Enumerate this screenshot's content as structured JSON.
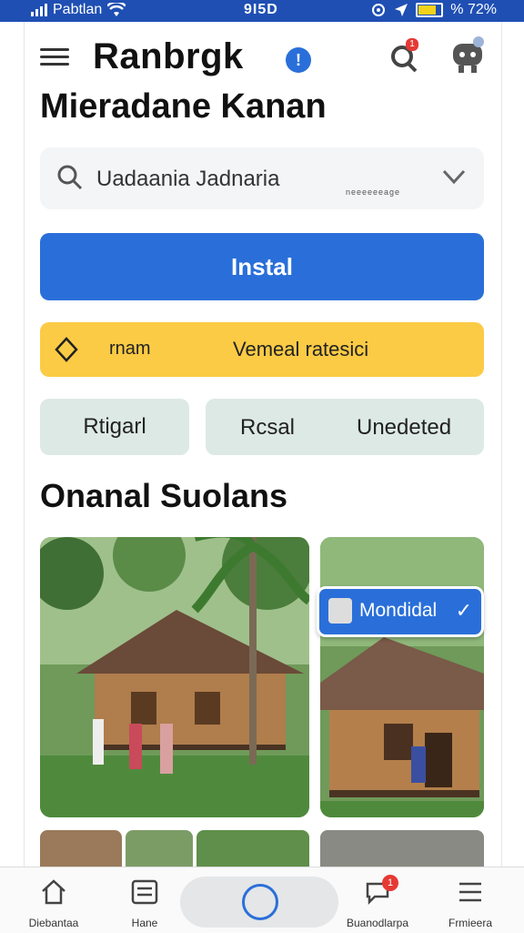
{
  "status_bar": {
    "carrier": "Pabtlan",
    "time": "9I5D",
    "battery": "%  72%"
  },
  "header": {
    "app_title": "Ranbrgk",
    "info_glyph": "!",
    "page_title": "Mieradane Kanan"
  },
  "search": {
    "value": "Uadaania Jadnaria",
    "hint": "neeeeeeage"
  },
  "install_button": {
    "label": "Instal"
  },
  "notice": {
    "tag": "rnam",
    "message": "Vemeal ratesici"
  },
  "chips": {
    "first": "Rtigarl",
    "second_a": "Rcsal",
    "second_b": "Unedeted"
  },
  "section": {
    "title": "Onanal Suolans"
  },
  "verified_badge": {
    "label": "Mondidal",
    "check": "✓"
  },
  "nav": {
    "items": [
      {
        "label": "Diebantaa",
        "icon": "home-icon"
      },
      {
        "label": "Hane",
        "icon": "list-icon"
      },
      {
        "label": "Buanodlarpa",
        "icon": "chat-icon",
        "badge": "1"
      },
      {
        "label": "Frmieera",
        "icon": "menu-icon"
      }
    ]
  },
  "colors": {
    "accent": "#2a6fd9",
    "notice": "#fbcb45",
    "chip": "#dde9e5",
    "status_bar": "#1f4fb3"
  }
}
